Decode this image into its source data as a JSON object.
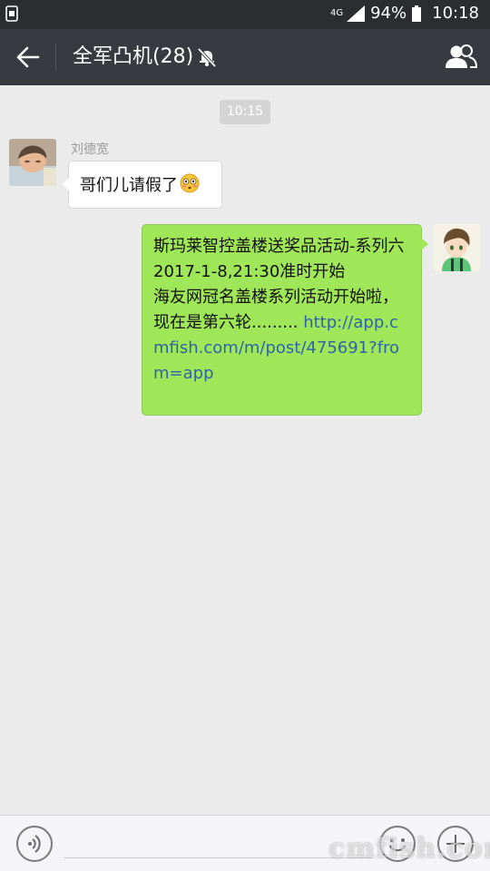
{
  "status_bar": {
    "network": "4G",
    "battery": "94%",
    "time": "10:18"
  },
  "header": {
    "title": "全军凸机(28)",
    "icons": [
      "back-arrow-icon",
      "mute-bell-icon",
      "group-members-icon"
    ]
  },
  "chat": {
    "time_divider": "10:15",
    "messages": [
      {
        "side": "left",
        "sender": "刘德宽",
        "text": "哥们儿请假了",
        "emoji": "flushed-face-emoji"
      },
      {
        "side": "right",
        "lines": [
          "斯玛莱智控盖楼送奖品活动-系列六",
          "2017-1-8,21:30准时开始",
          "海友网冠名盖楼系列活动开始啦，现在是第六轮......... "
        ],
        "link": "http://app.cmfish.com/m/post/475691?from=app"
      }
    ]
  },
  "input_bar": {
    "icons": [
      "voice-icon",
      "emoji-icon",
      "plus-icon"
    ]
  },
  "watermark": "cmfish.com",
  "colors": {
    "status_bg": "#2b2d31",
    "header_bg": "#393a3f",
    "chat_bg": "#ebebeb",
    "sent_bubble": "#9fe658",
    "link": "#2f64a8"
  }
}
